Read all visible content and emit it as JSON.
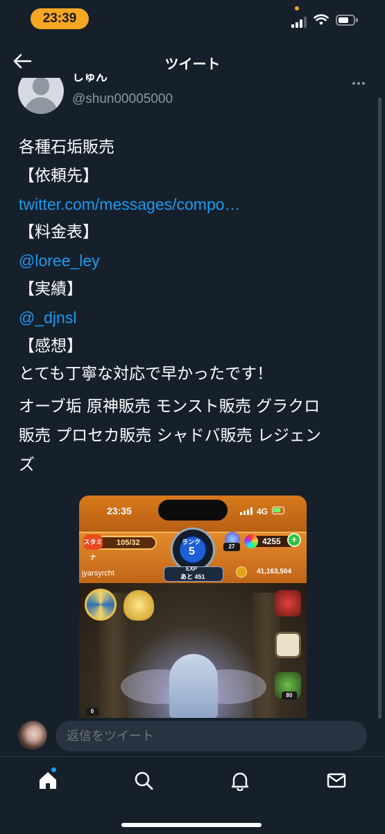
{
  "status_bar": {
    "time": "23:39"
  },
  "header": {
    "title": "ツイート"
  },
  "author": {
    "name": "しゅん",
    "handle": "@shun00005000"
  },
  "tweet": {
    "lines": [
      {
        "text": "各種石垢販売",
        "link": false
      },
      {
        "text": "【依頼先】",
        "link": false
      },
      {
        "text": "twitter.com/messages/compo…",
        "link": true
      },
      {
        "text": "【料金表】",
        "link": false
      },
      {
        "text": "@loree_ley",
        "link": true
      },
      {
        "text": "【実績】",
        "link": false
      },
      {
        "text": "@_djnsl",
        "link": true
      },
      {
        "text": "【感想】",
        "link": false
      },
      {
        "text": "とても丁寧な対応で早かったです！",
        "link": false
      }
    ],
    "tags_lines": [
      "オーブ垢 原神販売 モンスト販売 グラクロ",
      "販売 プロセカ販売 シャドバ販売 レジェン",
      "ズ"
    ]
  },
  "media": {
    "time": "23:35",
    "network": "4G",
    "stamina_label": "スタミナ",
    "stamina": "105/32",
    "rank_label": "ランク",
    "rank": "5",
    "exp_label": "EXP",
    "exp_remaining": "あと 451",
    "orb_count": "27",
    "gems": "4255",
    "plus": "+",
    "player_name": "jyarsyrcht",
    "coins": "41,163,504",
    "badge_a": "80",
    "badge_b": "0"
  },
  "reply": {
    "placeholder": "返信をツイート"
  },
  "nav": {
    "home_icon": "home-icon",
    "search_icon": "search-icon",
    "notifications_icon": "bell-icon",
    "messages_icon": "mail-icon"
  },
  "colors": {
    "background": "#15202b",
    "link": "#1d9bf0",
    "secondary_text": "#8b98a5",
    "time_pill": "#f5a623"
  }
}
